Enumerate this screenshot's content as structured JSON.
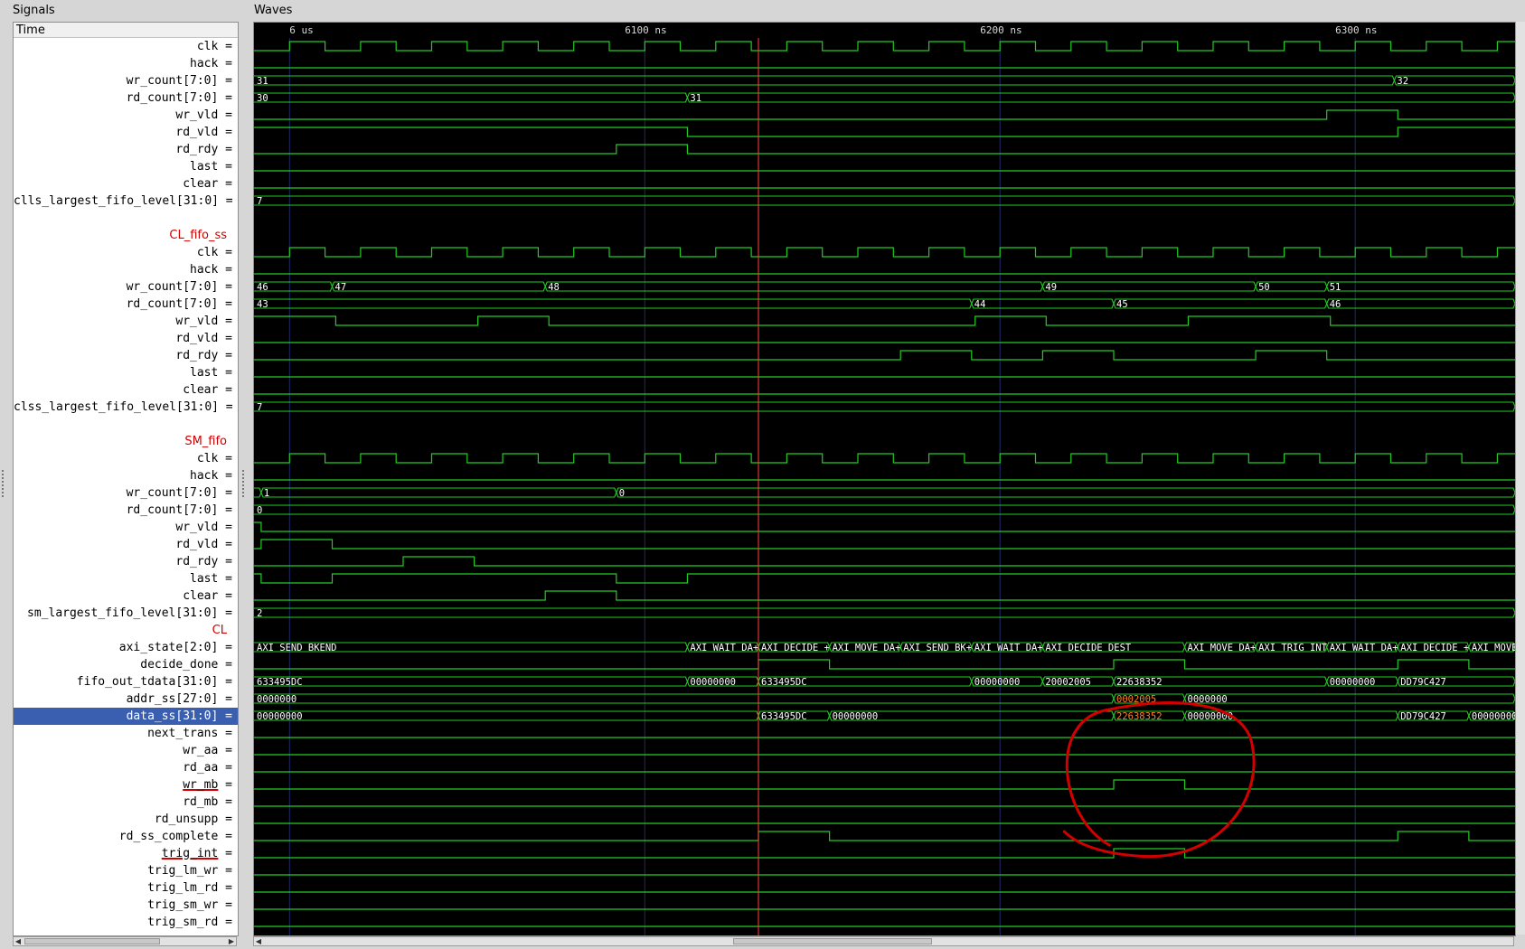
{
  "panels": {
    "signals_title": "Signals",
    "waves_title": "Waves",
    "time_header": "Time"
  },
  "time_markers": [
    {
      "label": "6 us",
      "t": 6000
    },
    {
      "label": "6100 ns",
      "t": 6100
    },
    {
      "label": "6200 ns",
      "t": 6200
    },
    {
      "label": "6300 ns",
      "t": 6300
    }
  ],
  "view": {
    "t_start": 5990,
    "t_end": 6345,
    "cursor_t": 6132,
    "clock_period": 20,
    "clock_phase": 0
  },
  "colors": {
    "wave": "#22cc22",
    "cursor": "#ff4040",
    "grid": "#1e2a6e",
    "highlight_text": "#ff7f27",
    "annotation": "#d40000",
    "group_label": "#d00000",
    "selection": "#3b5fb0"
  },
  "signals": [
    {
      "name": "clk",
      "kind": "clock"
    },
    {
      "name": "hack",
      "kind": "bit",
      "init": 0,
      "edges": []
    },
    {
      "name": "wr_count[7:0]",
      "kind": "bus",
      "segs": [
        [
          5990,
          "31"
        ],
        [
          6311,
          "32"
        ]
      ]
    },
    {
      "name": "rd_count[7:0]",
      "kind": "bus",
      "segs": [
        [
          5990,
          "30"
        ],
        [
          6112,
          "31"
        ]
      ]
    },
    {
      "name": "wr_vld",
      "kind": "bit",
      "init": 0,
      "edges": [
        6292,
        6312
      ]
    },
    {
      "name": "rd_vld",
      "kind": "bit",
      "init": 1,
      "edges": [
        6112,
        6312
      ]
    },
    {
      "name": "rd_rdy",
      "kind": "bit",
      "init": 0,
      "edges": [
        6092,
        6112
      ]
    },
    {
      "name": "last",
      "kind": "bit",
      "init": 0,
      "edges": []
    },
    {
      "name": "clear",
      "kind": "bit",
      "init": 0,
      "edges": []
    },
    {
      "name": "clls_largest_fifo_level[31:0]",
      "kind": "bus",
      "segs": [
        [
          5990,
          "7"
        ]
      ]
    },
    {
      "name": "",
      "kind": "blank"
    },
    {
      "name": "CL_fifo_ss",
      "kind": "group"
    },
    {
      "name": "clk",
      "kind": "clock"
    },
    {
      "name": "hack",
      "kind": "bit",
      "init": 0,
      "edges": []
    },
    {
      "name": "wr_count[7:0]",
      "kind": "bus",
      "segs": [
        [
          5990,
          "46"
        ],
        [
          6012,
          "47"
        ],
        [
          6072,
          "48"
        ],
        [
          6212,
          "49"
        ],
        [
          6272,
          "50"
        ],
        [
          6292,
          "51"
        ]
      ]
    },
    {
      "name": "rd_count[7:0]",
      "kind": "bus",
      "segs": [
        [
          5990,
          "43"
        ],
        [
          6192,
          "44"
        ],
        [
          6232,
          "45"
        ],
        [
          6292,
          "46"
        ]
      ]
    },
    {
      "name": "wr_vld",
      "kind": "bit",
      "init": 1,
      "edges": [
        6013,
        6053,
        6073,
        6193,
        6213,
        6253,
        6293
      ]
    },
    {
      "name": "rd_vld",
      "kind": "bit",
      "init": 0,
      "edges": []
    },
    {
      "name": "rd_rdy",
      "kind": "bit",
      "init": 0,
      "edges": [
        6172,
        6192,
        6212,
        6232,
        6272,
        6292
      ]
    },
    {
      "name": "last",
      "kind": "bit",
      "init": 0,
      "edges": []
    },
    {
      "name": "clear",
      "kind": "bit",
      "init": 0,
      "edges": []
    },
    {
      "name": "clss_largest_fifo_level[31:0]",
      "kind": "bus",
      "segs": [
        [
          5990,
          "7"
        ]
      ]
    },
    {
      "name": "",
      "kind": "blank"
    },
    {
      "name": "SM_fifo",
      "kind": "group"
    },
    {
      "name": "clk",
      "kind": "clock"
    },
    {
      "name": "hack",
      "kind": "bit",
      "init": 0,
      "edges": []
    },
    {
      "name": "wr_count[7:0]",
      "kind": "bus",
      "segs": [
        [
          5990,
          ""
        ],
        [
          5992,
          "1"
        ],
        [
          6092,
          "0"
        ]
      ]
    },
    {
      "name": "rd_count[7:0]",
      "kind": "bus",
      "segs": [
        [
          5990,
          "0"
        ]
      ]
    },
    {
      "name": "wr_vld",
      "kind": "bit",
      "init": 1,
      "edges": [
        5992
      ]
    },
    {
      "name": "rd_vld",
      "kind": "bit",
      "init": 0,
      "edges": [
        5992,
        6012
      ]
    },
    {
      "name": "rd_rdy",
      "kind": "bit",
      "init": 0,
      "edges": [
        6032,
        6052
      ]
    },
    {
      "name": "last",
      "kind": "bit",
      "init": 1,
      "edges": [
        5992,
        6012,
        6092,
        6112
      ]
    },
    {
      "name": "clear",
      "kind": "bit",
      "init": 0,
      "edges": [
        6072,
        6092
      ]
    },
    {
      "name": "sm_largest_fifo_level[31:0]",
      "kind": "bus",
      "segs": [
        [
          5990,
          "2"
        ]
      ]
    },
    {
      "name": "CL",
      "kind": "group"
    },
    {
      "name": "axi_state[2:0]",
      "kind": "bus",
      "segs": [
        [
          5990,
          "AXI SEND BKEND"
        ],
        [
          6112,
          "AXI WAIT DA+"
        ],
        [
          6132,
          "AXI DECIDE +"
        ],
        [
          6152,
          "AXI MOVE DA+"
        ],
        [
          6172,
          "AXI SEND BK+"
        ],
        [
          6192,
          "AXI WAIT DA+"
        ],
        [
          6212,
          "AXI DECIDE DEST"
        ],
        [
          6252,
          "AXI MOVE DA+"
        ],
        [
          6272,
          "AXI TRIG INT"
        ],
        [
          6292,
          "AXI WAIT DA+"
        ],
        [
          6312,
          "AXI DECIDE +"
        ],
        [
          6332,
          "AXI MOVE"
        ]
      ]
    },
    {
      "name": "decide_done",
      "kind": "bit",
      "init": 0,
      "edges": [
        6132,
        6152,
        6232,
        6252,
        6312,
        6332
      ]
    },
    {
      "name": "fifo_out_tdata[31:0]",
      "kind": "bus",
      "segs": [
        [
          5990,
          "633495DC"
        ],
        [
          6112,
          "00000000"
        ],
        [
          6132,
          "633495DC"
        ],
        [
          6192,
          "00000000"
        ],
        [
          6212,
          "20002005"
        ],
        [
          6232,
          "22638352"
        ],
        [
          6292,
          "00000000"
        ],
        [
          6312,
          "DD79C427"
        ]
      ]
    },
    {
      "name": "addr_ss[27:0]",
      "kind": "bus",
      "segs": [
        [
          5990,
          "0000000"
        ],
        [
          6232,
          "0002005",
          "hl"
        ],
        [
          6252,
          "0000000"
        ]
      ]
    },
    {
      "name": "data_ss[31:0]",
      "kind": "bus",
      "selected": true,
      "segs": [
        [
          5990,
          "00000000"
        ],
        [
          6132,
          "633495DC"
        ],
        [
          6152,
          "00000000"
        ],
        [
          6232,
          "22638352",
          "hl"
        ],
        [
          6252,
          "00000000"
        ],
        [
          6312,
          "DD79C427"
        ],
        [
          6332,
          "00000000"
        ]
      ]
    },
    {
      "name": "next_trans",
      "kind": "bit",
      "init": 0,
      "edges": []
    },
    {
      "name": "wr_aa",
      "kind": "bit",
      "init": 0,
      "edges": []
    },
    {
      "name": "rd_aa",
      "kind": "bit",
      "init": 0,
      "edges": []
    },
    {
      "name": "wr_mb",
      "kind": "bit",
      "init": 0,
      "edges": [
        6232,
        6252
      ],
      "underline": true
    },
    {
      "name": "rd_mb",
      "kind": "bit",
      "init": 0,
      "edges": []
    },
    {
      "name": "rd_unsupp",
      "kind": "bit",
      "init": 0,
      "edges": []
    },
    {
      "name": "rd_ss_complete",
      "kind": "bit",
      "init": 0,
      "edges": [
        6132,
        6152,
        6312,
        6332
      ]
    },
    {
      "name": "trig_int",
      "kind": "bit",
      "init": 0,
      "edges": [
        6232,
        6252
      ],
      "underline": true
    },
    {
      "name": "trig_lm_wr",
      "kind": "bit",
      "init": 0,
      "edges": []
    },
    {
      "name": "trig_lm_rd",
      "kind": "bit",
      "init": 0,
      "edges": []
    },
    {
      "name": "trig_sm_wr",
      "kind": "bit",
      "init": 0,
      "edges": []
    },
    {
      "name": "trig_sm_rd",
      "kind": "bit",
      "init": 0,
      "edges": []
    }
  ]
}
